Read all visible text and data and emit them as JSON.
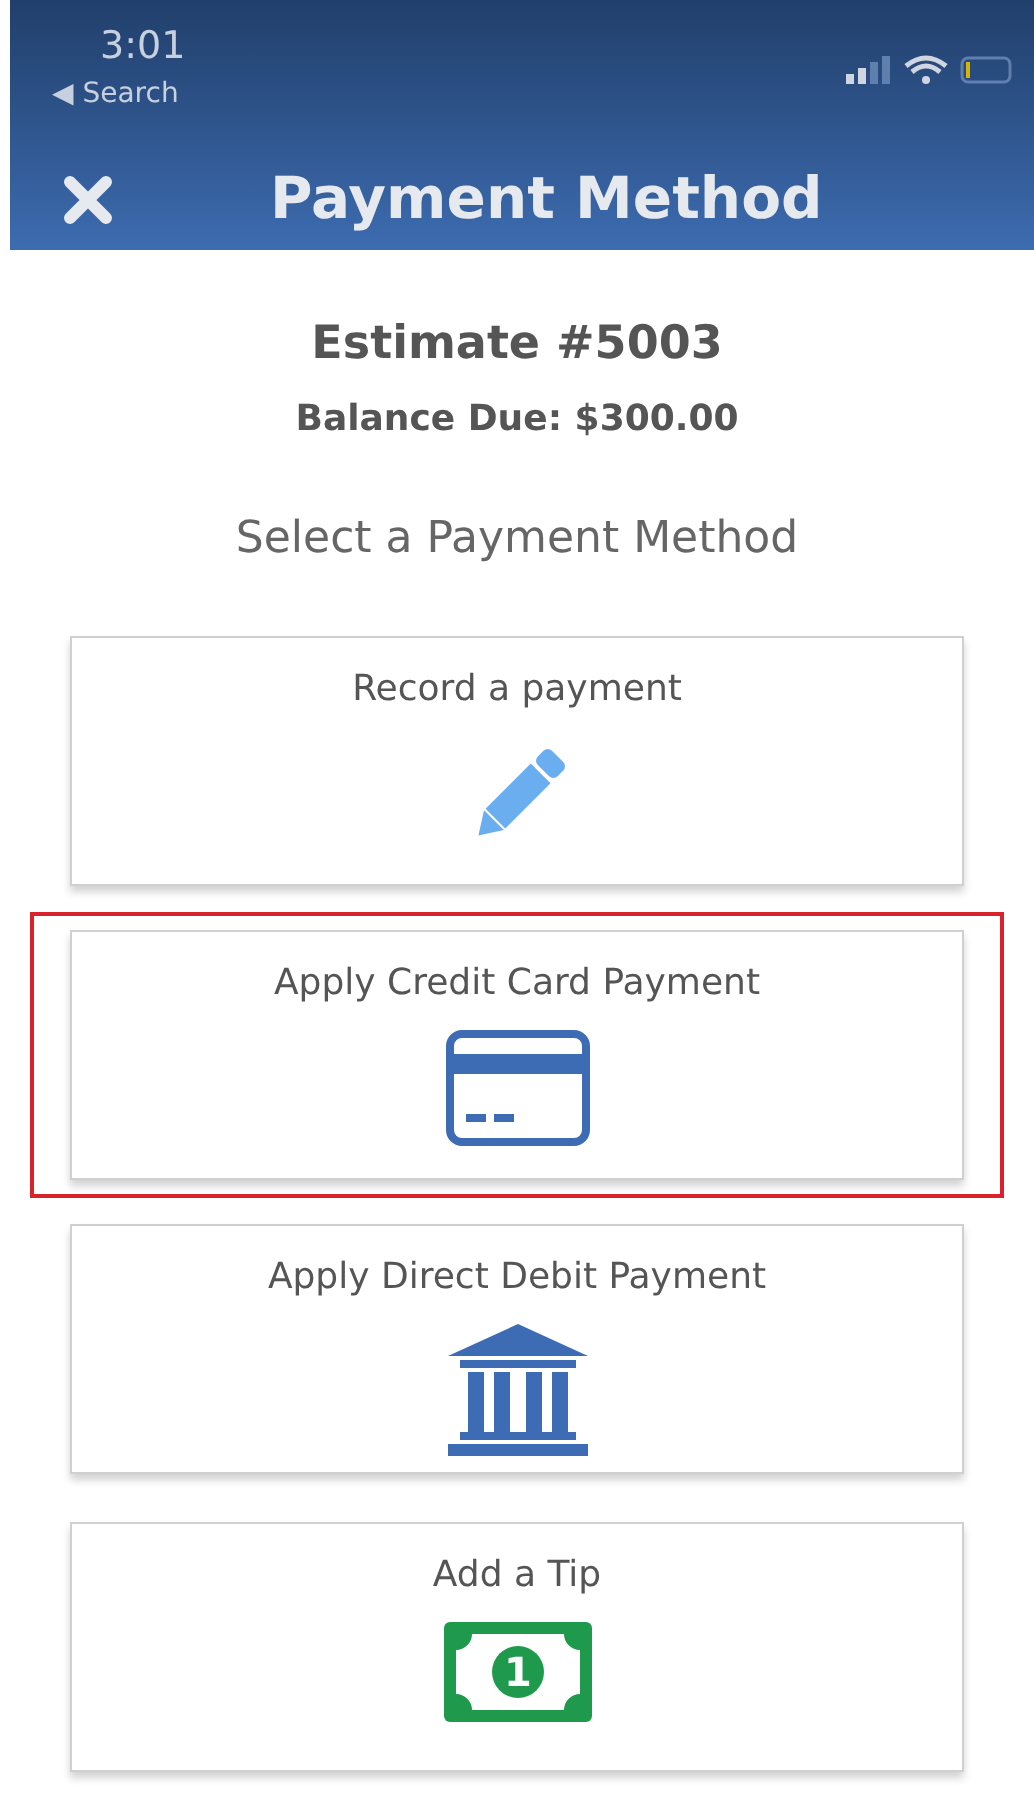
{
  "status_bar": {
    "time": "3:01",
    "back_label": "◀ Search"
  },
  "header": {
    "title": "Payment Method"
  },
  "estimate": {
    "title": "Estimate #5003",
    "balance": "Balance Due: $300.00"
  },
  "prompt": "Select a Payment Method",
  "options": [
    {
      "label": "Record a payment",
      "kind": "pencil",
      "highlighted": false
    },
    {
      "label": "Apply Credit Card Payment",
      "kind": "card",
      "highlighted": true
    },
    {
      "label": "Apply Direct Debit Payment",
      "kind": "bank",
      "highlighted": false
    },
    {
      "label": "Add a Tip",
      "kind": "cash",
      "icon_text": "1",
      "highlighted": false
    }
  ]
}
